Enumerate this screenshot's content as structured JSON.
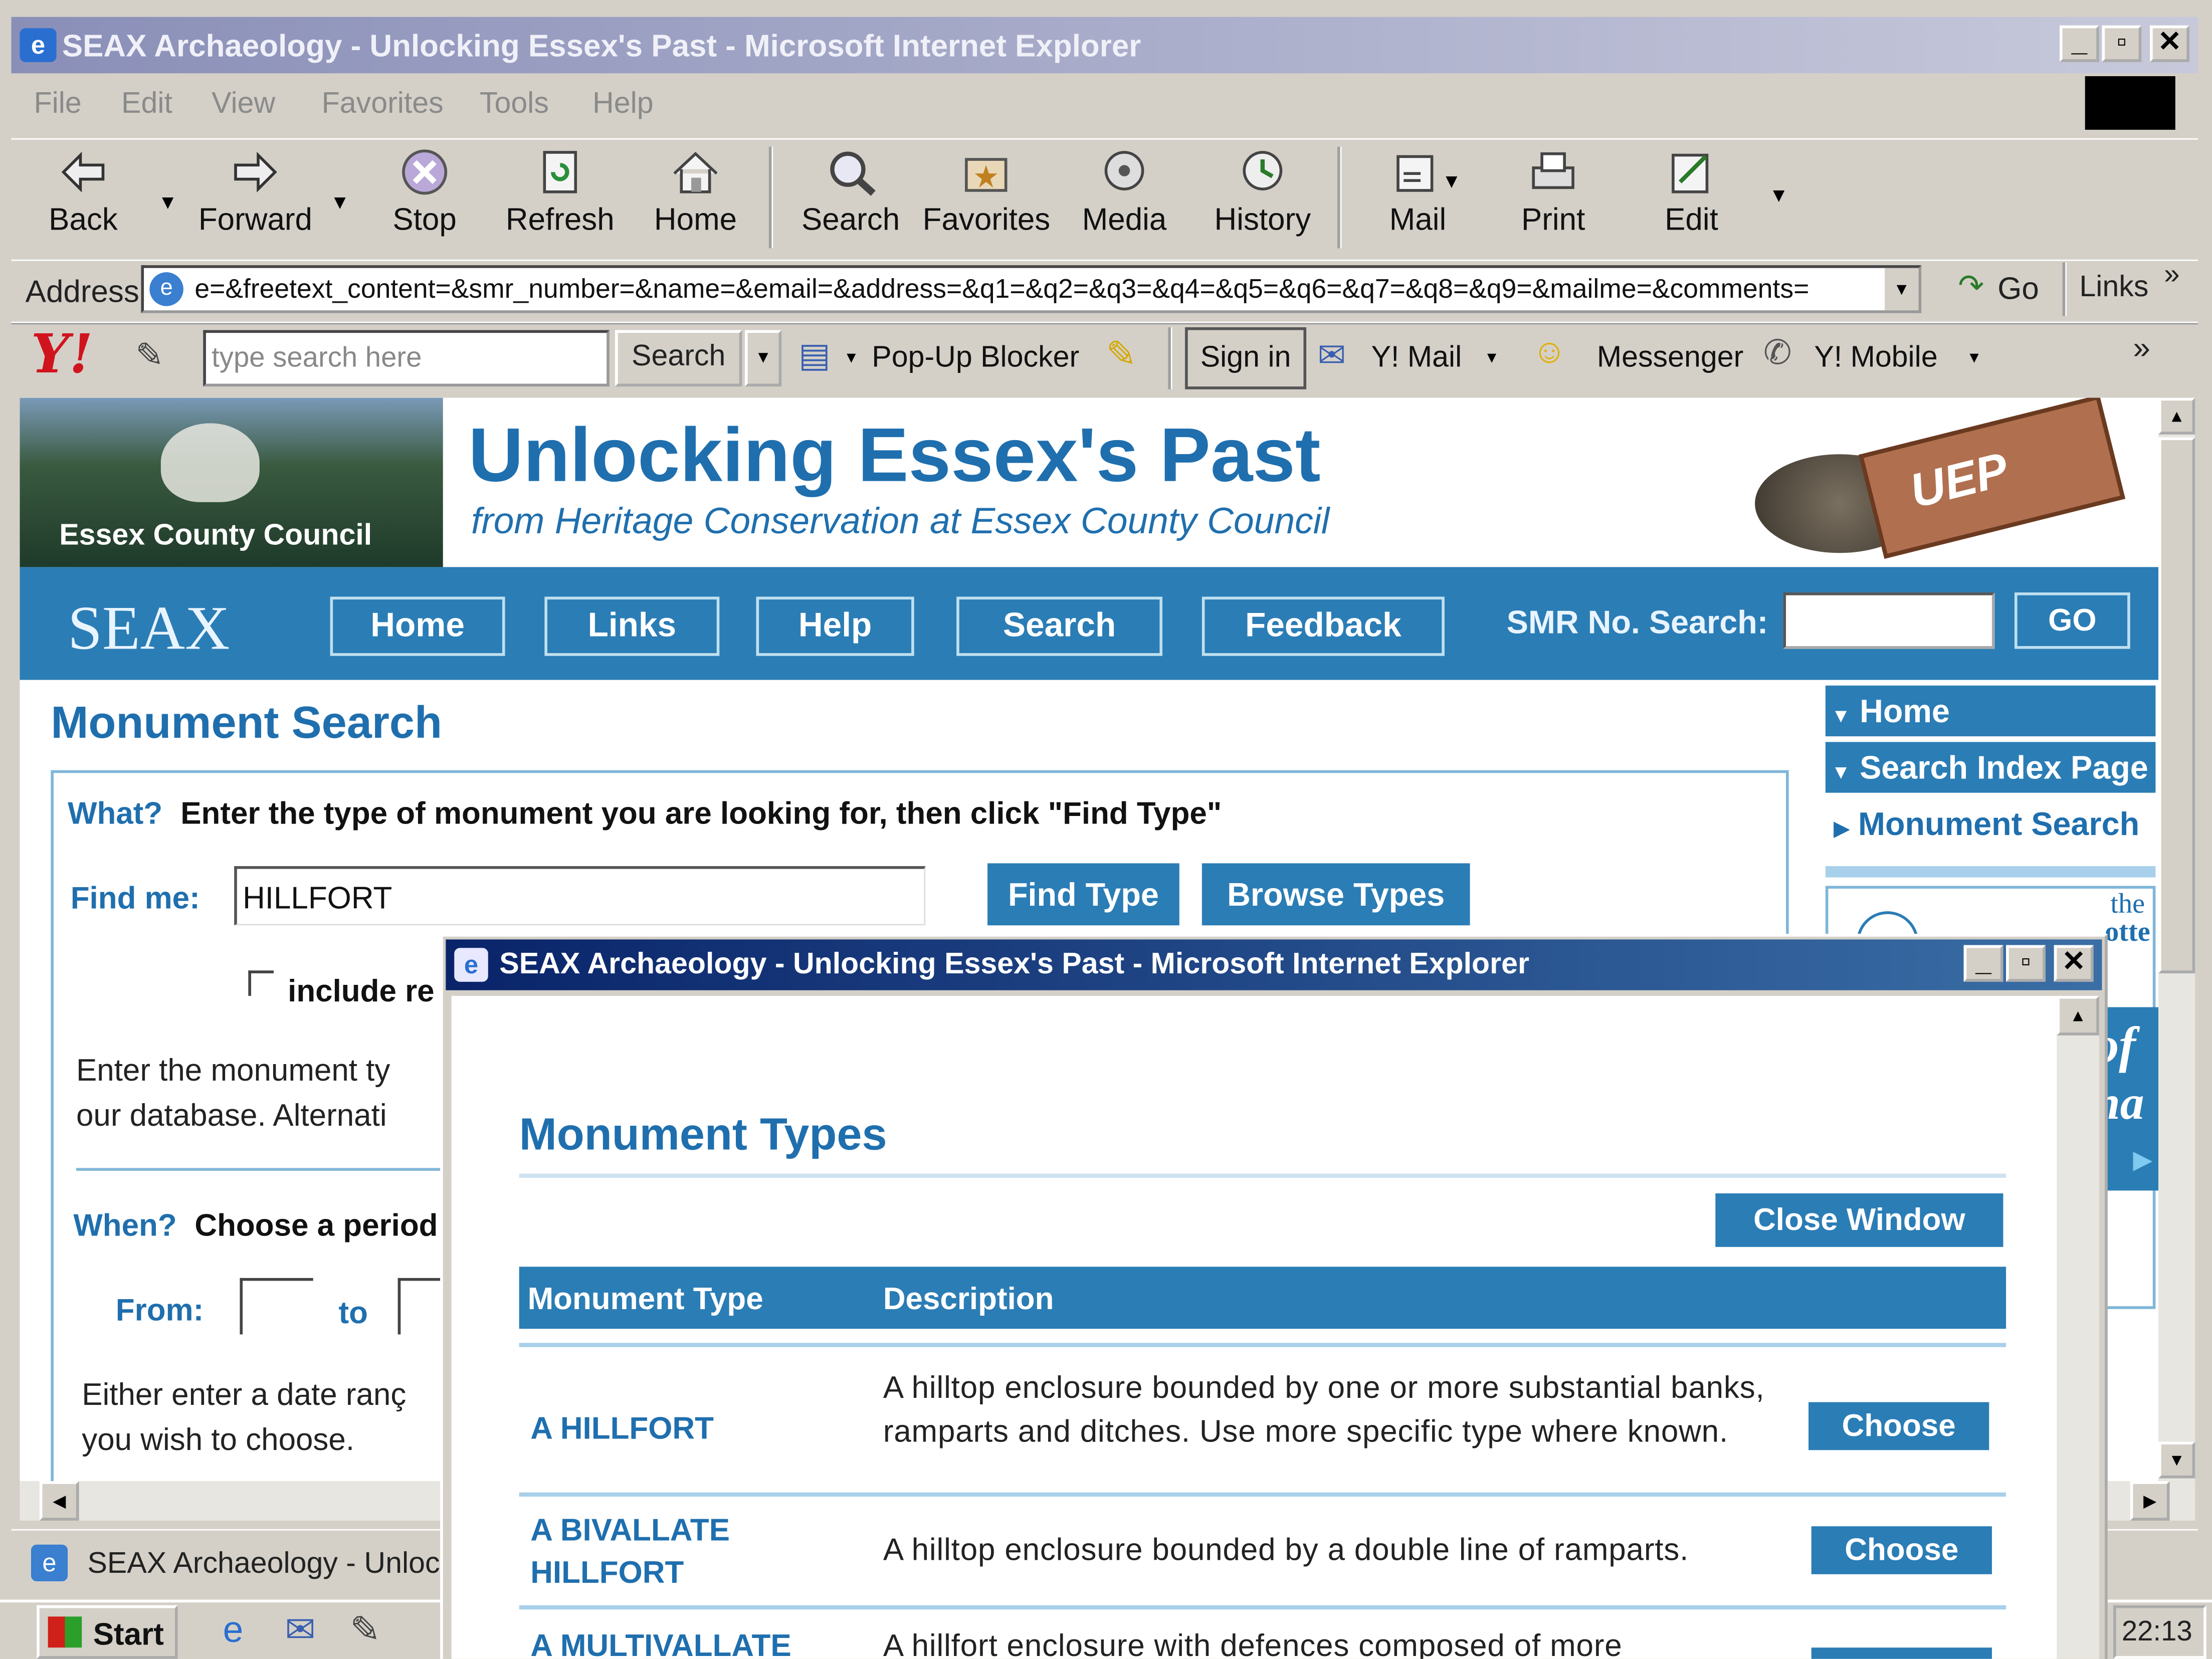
{
  "main_window": {
    "title": "SEAX Archaeology - Unlocking Essex's Past - Microsoft Internet Explorer",
    "menu": [
      "File",
      "Edit",
      "View",
      "Favorites",
      "Tools",
      "Help"
    ],
    "toolbar": {
      "back": "Back",
      "forward": "Forward",
      "stop": "Stop",
      "refresh": "Refresh",
      "home": "Home",
      "search": "Search",
      "favorites": "Favorites",
      "media": "Media",
      "history": "History",
      "mail": "Mail",
      "print": "Print",
      "edit": "Edit"
    },
    "address": {
      "label": "Address",
      "url": "e=&freetext_content=&smr_number=&name=&email=&address=&q1=&q2=&q3=&q4=&q5=&q6=&q7=&q8=&q9=&mailme=&comments=",
      "go": "Go",
      "links": "Links"
    },
    "yahoo_bar": {
      "logo": "Y!",
      "search_placeholder": "type search here",
      "search_button": "Search",
      "popup_blocker": "Pop-Up Blocker",
      "sign_in": "Sign in",
      "mail": "Y! Mail",
      "messenger": "Messenger",
      "mobile": "Y! Mobile"
    }
  },
  "site": {
    "council_name": "Essex County Council",
    "title": "Unlocking Essex's Past",
    "subtitle": "from Heritage Conservation at Essex County Council",
    "logo_text": "UEP",
    "seax": "SEAX",
    "nav": [
      "Home",
      "Links",
      "Help",
      "Search",
      "Feedback"
    ],
    "smr_label": "SMR No. Search:",
    "smr_go": "GO",
    "sidebar": {
      "home": "Home",
      "search_index": "Search Index Page",
      "monument_search": "Monument Search",
      "partial_1": "the",
      "partial_2": "otte",
      "partial_big1": "of",
      "partial_big2": "na"
    }
  },
  "monument_search": {
    "heading": "Monument Search",
    "what_label": "What?",
    "what_text": "Enter the type of monument you are looking for, then click \"Find Type\"",
    "find_label": "Find me:",
    "find_value": "HILLFORT",
    "find_type_button": "Find Type",
    "browse_button": "Browse Types",
    "include_label": "include re",
    "info_line1": "Enter the monument ty",
    "info_line2": "our database. Alternati",
    "when_label": "When?",
    "when_text": "Choose a period",
    "from_label": "From:",
    "to_label": "to",
    "date_line1": "Either enter a date ranç",
    "date_line2": "you wish to choose."
  },
  "taskbar": {
    "task_label": "SEAX Archaeology - Unlock",
    "start": "Start",
    "clock": "22:13"
  },
  "popup": {
    "title": "SEAX Archaeology - Unlocking Essex's Past - Microsoft Internet Explorer",
    "heading": "Monument Types",
    "close_button": "Close Window",
    "table": {
      "headers": [
        "Monument Type",
        "Description"
      ],
      "rows": [
        {
          "type": "A HILLFORT",
          "description": "A hilltop enclosure bounded by one or more substantial banks, ramparts and ditches. Use more specific type where known.",
          "action": "Choose"
        },
        {
          "type": "A BIVALLATE HILLFORT",
          "description": "A hilltop enclosure bounded by a double line of ramparts.",
          "action": "Choose"
        },
        {
          "type": "A MULTIVALLATE",
          "description": "A hillfort enclosure with defences composed of more",
          "action": "Choose"
        }
      ]
    }
  },
  "colors": {
    "site_blue": "#2b7db5",
    "title_blue": "#1f6fae",
    "xp_titlebar": "#0a246a",
    "inactive_titlebar": "#8a8fb8"
  }
}
